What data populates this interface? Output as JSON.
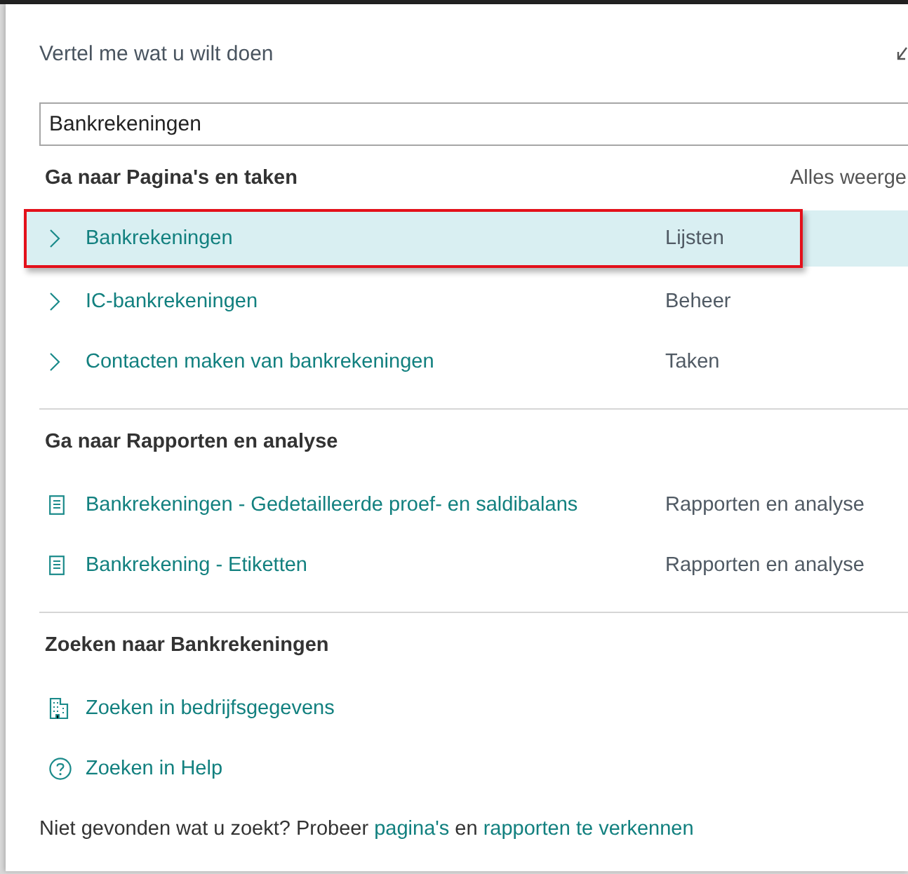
{
  "dialog": {
    "title": "Vertel me wat u wilt doen"
  },
  "search": {
    "value": "Bankrekeningen"
  },
  "sections": [
    {
      "heading": "Ga naar Pagina's en taken",
      "action": "Alles weerge",
      "items": [
        {
          "kind": "page",
          "label": "Bankrekeningen",
          "category": "Lijsten",
          "selected": true
        },
        {
          "kind": "page",
          "label": "IC-bankrekeningen",
          "category": "Beheer",
          "selected": false
        },
        {
          "kind": "page",
          "label": "Contacten maken van bankrekeningen",
          "category": "Taken",
          "selected": false
        }
      ]
    },
    {
      "heading": "Ga naar Rapporten en analyse",
      "items": [
        {
          "kind": "report",
          "label": "Bankrekeningen - Gedetailleerde proef- en saldibalans",
          "category": "Rapporten en analyse",
          "selected": false
        },
        {
          "kind": "report",
          "label": "Bankrekening - Etiketten",
          "category": "Rapporten en analyse",
          "selected": false
        }
      ]
    },
    {
      "heading": "Zoeken naar Bankrekeningen",
      "items": [
        {
          "kind": "company",
          "label": "Zoeken in bedrijfsgegevens",
          "selected": false
        },
        {
          "kind": "help",
          "label": "Zoeken in Help",
          "selected": false
        }
      ]
    }
  ],
  "footer": {
    "text": "Niet gevonden wat u zoekt? Probeer",
    "link_1": "pagina's",
    "between": "en",
    "link_2": "rapporten te verkennen"
  }
}
